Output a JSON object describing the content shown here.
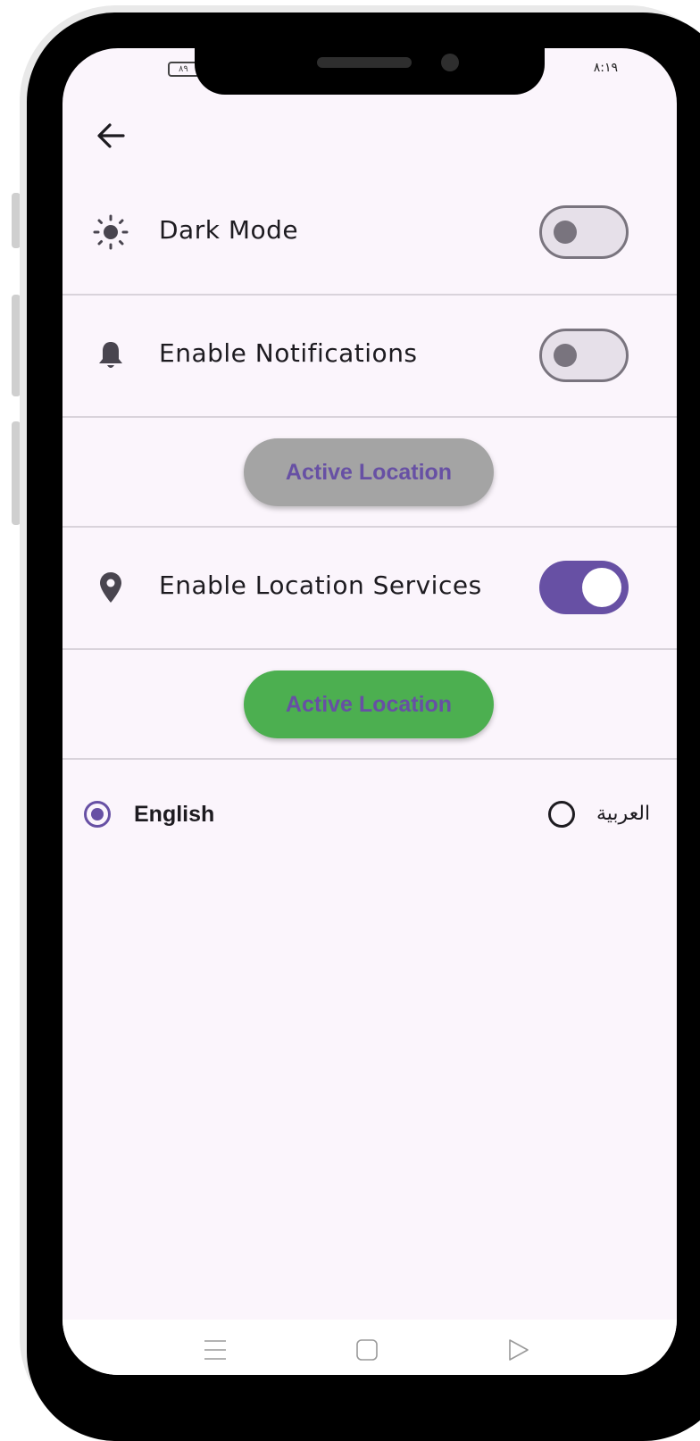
{
  "status_bar": {
    "battery": "٨٩",
    "time": "٨:١٩"
  },
  "header": {
    "back_icon": "arrow-left-icon"
  },
  "settings": [
    {
      "id": "dark-mode",
      "icon": "sun-icon",
      "label": "Dark Mode",
      "enabled": false
    },
    {
      "id": "notifications",
      "icon": "bell-icon",
      "label": "Enable Notifications",
      "enabled": false
    },
    {
      "id": "location-services",
      "icon": "location-pin-icon",
      "label": "Enable Location Services",
      "enabled": true
    }
  ],
  "buttons": {
    "location_inactive": {
      "label": "Active Location",
      "color": "#a4a4a4"
    },
    "location_active": {
      "label": "Active Location",
      "color": "#4caf50"
    }
  },
  "language": {
    "options": [
      {
        "label": "English",
        "selected": true
      },
      {
        "label": "العربية",
        "selected": false
      }
    ]
  },
  "colors": {
    "accent": "#6750a4",
    "background": "#fbf5fc",
    "switch_off_track": "#e6e0e9"
  },
  "nav_bar": {
    "icons": [
      "menu-icon",
      "home-square-icon",
      "back-triangle-icon"
    ]
  }
}
